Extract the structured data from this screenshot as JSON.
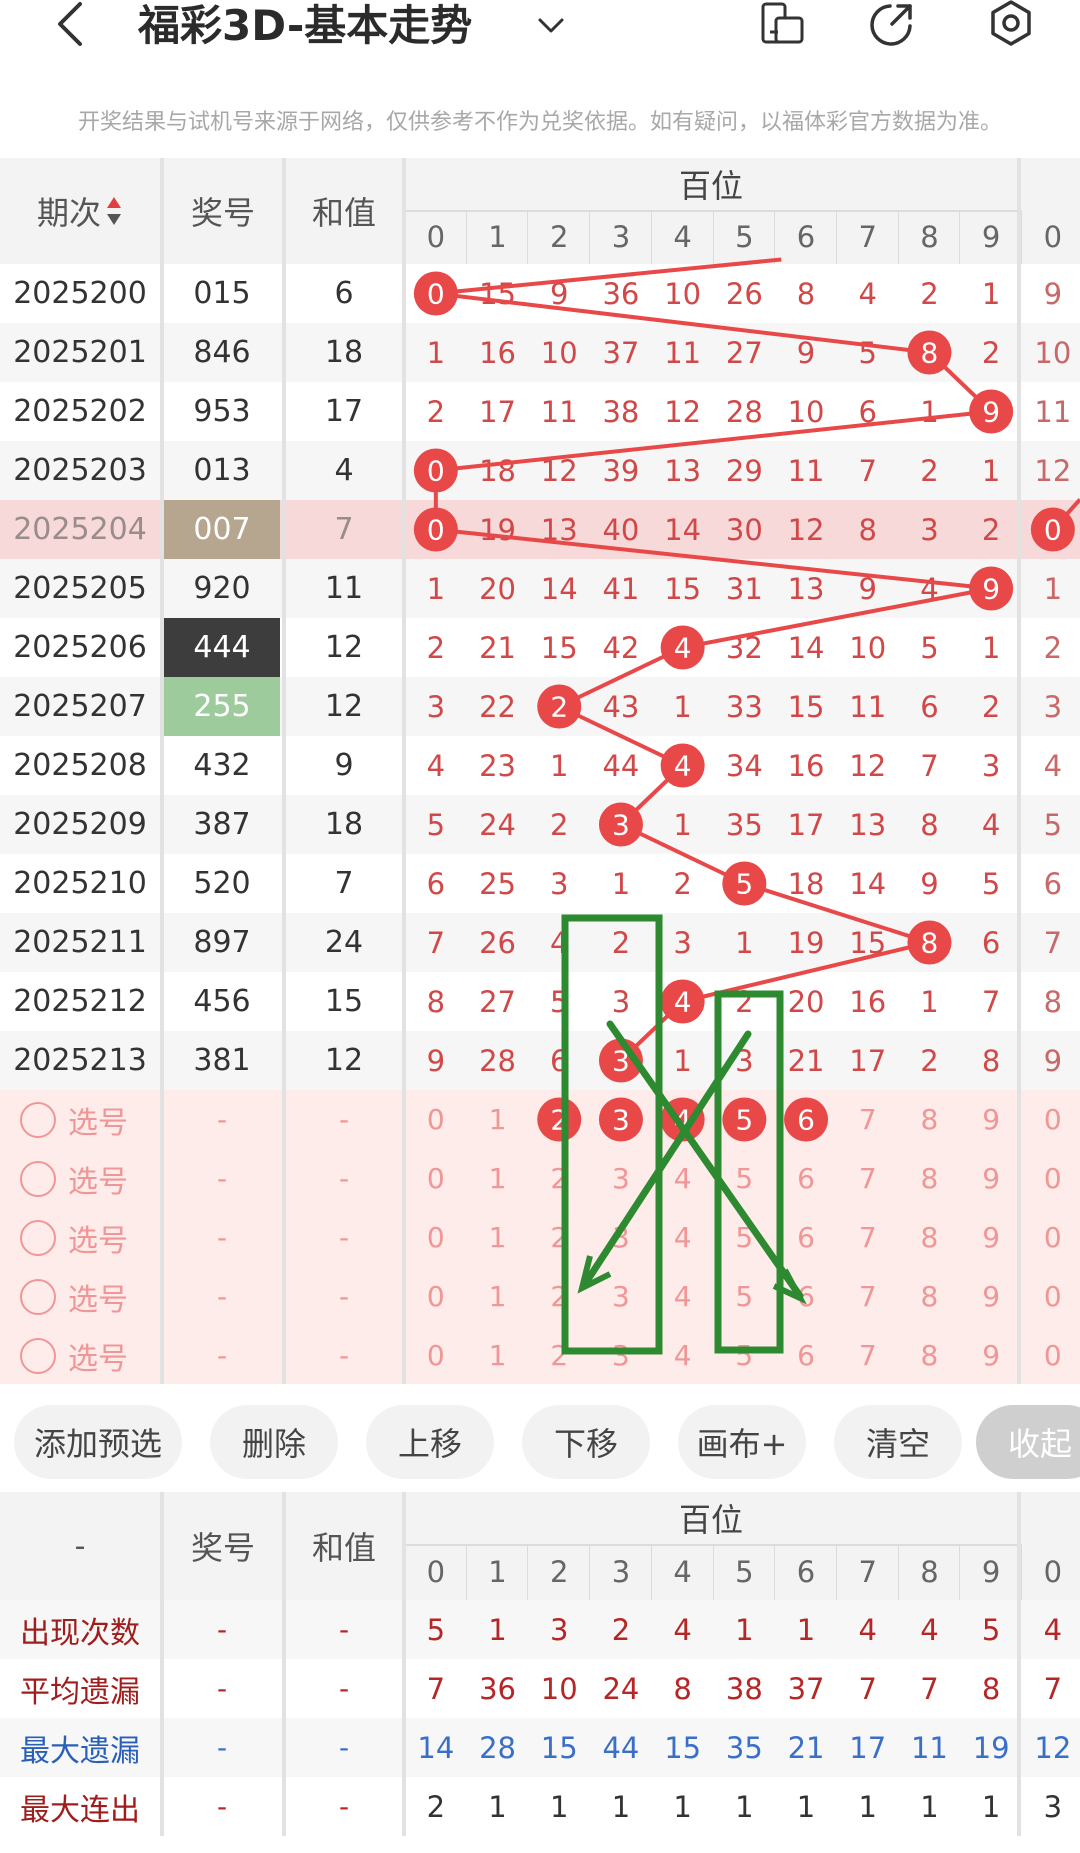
{
  "header": {
    "title": "福彩3D-基本走势"
  },
  "notice": "开奖结果与试机号来源于网络，仅供参考不作为兑奖依据。如有疑问，以福体彩官方数据为准。",
  "table": {
    "headers": {
      "period": "期次",
      "number": "奖号",
      "sum": "和值",
      "group": "百位"
    },
    "digits": [
      "0",
      "1",
      "2",
      "3",
      "4",
      "5",
      "6",
      "7",
      "8",
      "9",
      "0"
    ],
    "rows": [
      {
        "period": "2025200",
        "number": "015",
        "sum": "6",
        "cells": [
          "0",
          "15",
          "9",
          "36",
          "10",
          "26",
          "8",
          "4",
          "2",
          "1",
          "9"
        ],
        "hit": 0
      },
      {
        "period": "2025201",
        "number": "846",
        "sum": "18",
        "cells": [
          "1",
          "16",
          "10",
          "37",
          "11",
          "27",
          "9",
          "5",
          "8",
          "2",
          "10"
        ],
        "hit": 8
      },
      {
        "period": "2025202",
        "number": "953",
        "sum": "17",
        "cells": [
          "2",
          "17",
          "11",
          "38",
          "12",
          "28",
          "10",
          "6",
          "1",
          "9",
          "11"
        ],
        "hit": 9
      },
      {
        "period": "2025203",
        "number": "013",
        "sum": "4",
        "cells": [
          "0",
          "18",
          "12",
          "39",
          "13",
          "29",
          "11",
          "7",
          "2",
          "1",
          "12"
        ],
        "hit": 0
      },
      {
        "period": "2025204",
        "number": "007",
        "sum": "7",
        "cells": [
          "0",
          "19",
          "13",
          "40",
          "14",
          "30",
          "12",
          "8",
          "3",
          "2",
          "0"
        ],
        "hit": 0,
        "highlight": true
      },
      {
        "period": "2025205",
        "number": "920",
        "sum": "11",
        "cells": [
          "1",
          "20",
          "14",
          "41",
          "15",
          "31",
          "13",
          "9",
          "4",
          "9",
          "1"
        ],
        "hit": 9
      },
      {
        "period": "2025206",
        "number": "444",
        "sum": "12",
        "cells": [
          "2",
          "21",
          "15",
          "42",
          "4",
          "32",
          "14",
          "10",
          "5",
          "1",
          "2"
        ],
        "hit": 4,
        "numStyle": "dark"
      },
      {
        "period": "2025207",
        "number": "255",
        "sum": "12",
        "cells": [
          "3",
          "22",
          "2",
          "43",
          "1",
          "33",
          "15",
          "11",
          "6",
          "2",
          "3"
        ],
        "hit": 2,
        "numStyle": "green"
      },
      {
        "period": "2025208",
        "number": "432",
        "sum": "9",
        "cells": [
          "4",
          "23",
          "1",
          "44",
          "4",
          "34",
          "16",
          "12",
          "7",
          "3",
          "4"
        ],
        "hit": 4
      },
      {
        "period": "2025209",
        "number": "387",
        "sum": "18",
        "cells": [
          "5",
          "24",
          "2",
          "3",
          "1",
          "35",
          "17",
          "13",
          "8",
          "4",
          "5"
        ],
        "hit": 3
      },
      {
        "period": "2025210",
        "number": "520",
        "sum": "7",
        "cells": [
          "6",
          "25",
          "3",
          "1",
          "2",
          "5",
          "18",
          "14",
          "9",
          "5",
          "6"
        ],
        "hit": 5
      },
      {
        "period": "2025211",
        "number": "897",
        "sum": "24",
        "cells": [
          "7",
          "26",
          "4",
          "2",
          "3",
          "1",
          "19",
          "15",
          "8",
          "6",
          "7"
        ],
        "hit": 8
      },
      {
        "period": "2025212",
        "number": "456",
        "sum": "15",
        "cells": [
          "8",
          "27",
          "5",
          "3",
          "4",
          "2",
          "20",
          "16",
          "1",
          "7",
          "8"
        ],
        "hit": 4
      },
      {
        "period": "2025213",
        "number": "381",
        "sum": "12",
        "cells": [
          "9",
          "28",
          "6",
          "3",
          "1",
          "3",
          "21",
          "17",
          "2",
          "8",
          "9"
        ],
        "hit": 3
      }
    ],
    "pick_label": "选号",
    "dash": "-",
    "pick_rows": [
      {
        "cells": [
          "0",
          "1",
          "2",
          "3",
          "4",
          "5",
          "6",
          "7",
          "8",
          "9",
          "0"
        ],
        "selected": [
          2,
          3,
          4,
          5,
          6
        ]
      },
      {
        "cells": [
          "0",
          "1",
          "2",
          "3",
          "4",
          "5",
          "6",
          "7",
          "8",
          "9",
          "0"
        ],
        "selected": []
      },
      {
        "cells": [
          "0",
          "1",
          "2",
          "3",
          "4",
          "5",
          "6",
          "7",
          "8",
          "9",
          "0"
        ],
        "selected": []
      },
      {
        "cells": [
          "0",
          "1",
          "2",
          "3",
          "4",
          "5",
          "6",
          "7",
          "8",
          "9",
          "0"
        ],
        "selected": []
      },
      {
        "cells": [
          "0",
          "1",
          "2",
          "3",
          "4",
          "5",
          "6",
          "7",
          "8",
          "9",
          "0"
        ],
        "selected": []
      }
    ]
  },
  "actions": {
    "add_preset": "添加预选",
    "delete": "删除",
    "move_up": "上移",
    "move_down": "下移",
    "canvas": "画布+",
    "clear": "清空",
    "collapse": "收起"
  },
  "stats": {
    "headers": {
      "corner": "-",
      "number": "奖号",
      "sum": "和值",
      "group": "百位"
    },
    "digits": [
      "0",
      "1",
      "2",
      "3",
      "4",
      "5",
      "6",
      "7",
      "8",
      "9",
      "0"
    ],
    "rows": [
      {
        "label": "出现次数",
        "kind": "red",
        "cells": [
          "5",
          "1",
          "3",
          "2",
          "4",
          "1",
          "1",
          "4",
          "4",
          "5",
          "4"
        ]
      },
      {
        "label": "平均遗漏",
        "kind": "red",
        "cells": [
          "7",
          "36",
          "10",
          "24",
          "8",
          "38",
          "37",
          "7",
          "7",
          "8",
          "7"
        ]
      },
      {
        "label": "最大遗漏",
        "kind": "blue",
        "cells": [
          "14",
          "28",
          "15",
          "44",
          "15",
          "35",
          "21",
          "17",
          "11",
          "19",
          "12"
        ]
      },
      {
        "label": "最大连出",
        "kind": "red",
        "cells": [
          "2",
          "1",
          "1",
          "1",
          "1",
          "1",
          "1",
          "1",
          "1",
          "1",
          "3"
        ]
      }
    ]
  },
  "colors": {
    "accent": "#e84848",
    "cellText": "#d04848",
    "missText": "#c86868",
    "pickText": "#f09696",
    "pickBg": "#fdecea",
    "highlightRow": "#f7d9d9",
    "dark": "#3d3d3d",
    "green": "#9ecb9c",
    "tan": "#b6a58f",
    "draw": "#2e8a30",
    "blueText": "#3a6fc8",
    "statRed": "#b52727"
  },
  "icons": [
    "back-icon",
    "dropdown-icon",
    "phone-landscape-icon",
    "share-icon",
    "settings-icon",
    "sort-icon"
  ]
}
